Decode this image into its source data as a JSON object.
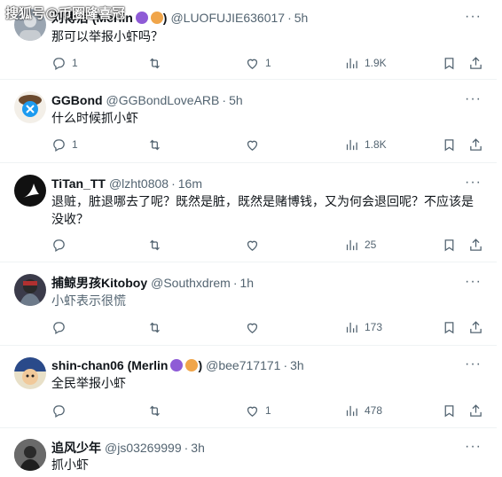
{
  "watermark": "搜狐号@币圈隆喜冠",
  "posts": [
    {
      "name": "刘傅洁 (Merlin",
      "name_suffix": ")",
      "handle": "@LUOFUJIE636017",
      "time": "5h",
      "text": "那可以举报小虾吗？",
      "reply": "1",
      "repost": "",
      "like": "1",
      "views": "1.9K",
      "avatar_color": "#9aa5b1"
    },
    {
      "name": "GGBond",
      "handle": "@GGBondLoveARB",
      "time": "5h",
      "text": "什么时候抓小虾",
      "reply": "1",
      "repost": "",
      "like": "",
      "views": "1.8K",
      "avatar_color": "#1d9bf0"
    },
    {
      "name": "TiTan_TT",
      "handle": "@lzht0808",
      "time": "16m",
      "text": "退赃，脏退哪去了呢？既然是脏，既然是赌博钱，又为何会退回呢？不应该是没收？",
      "reply": "",
      "repost": "",
      "like": "",
      "views": "25",
      "avatar_color": "#111111"
    },
    {
      "name": "捕鲸男孩Kitoboy",
      "handle": "@Southxdrem",
      "time": "1h",
      "text": "小虾表示很慌",
      "reply": "",
      "repost": "",
      "like": "",
      "views": "173",
      "avatar_color": "#3b3b4a"
    },
    {
      "name": "shin-chan06 (Merlin",
      "name_suffix": ")",
      "handle": "@bee717171",
      "time": "3h",
      "text": "全民举报小虾",
      "reply": "",
      "repost": "",
      "like": "1",
      "views": "478",
      "avatar_color": "#2a4a8a"
    },
    {
      "name": "追风少年",
      "handle": "@js03269999",
      "time": "3h",
      "text": "抓小虾",
      "avatar_color": "#555555"
    }
  ],
  "colors": {
    "text_primary": "#0f1419",
    "text_secondary": "#536471",
    "divider": "#eff3f4",
    "badge_purple": "#8e5bd6",
    "badge_orange": "#f0a54a"
  },
  "icons": [
    "more-icon",
    "reply-icon",
    "repost-icon",
    "like-icon",
    "views-icon",
    "bookmark-icon",
    "share-icon"
  ]
}
